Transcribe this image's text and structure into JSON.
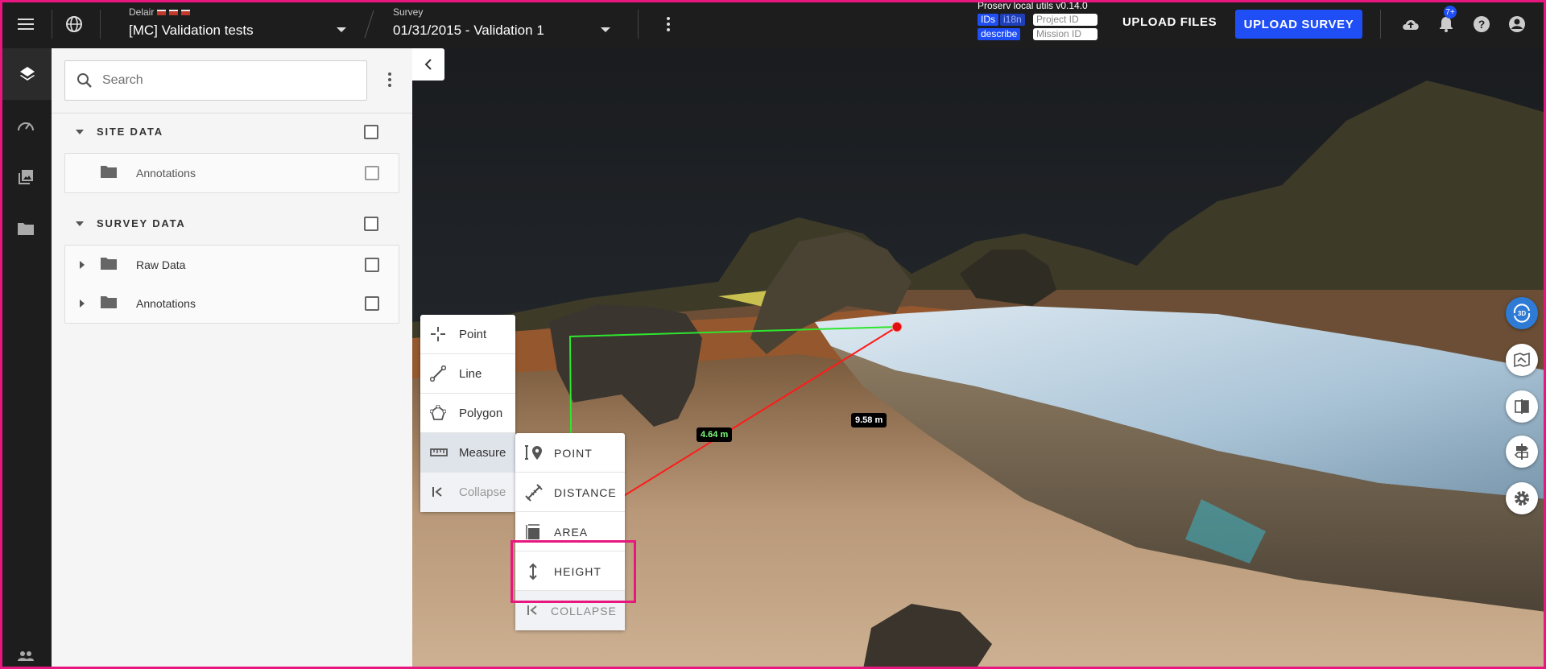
{
  "topbar": {
    "menu_icon": "hamburger-menu-icon",
    "globe_icon": "globe-icon",
    "project_caption": "Delair",
    "project_name": "[MC] Validation tests",
    "survey_caption": "Survey",
    "survey_name": "01/31/2015 - Validation 1",
    "dev_title": "Proserv local utils v0.14.0",
    "chip_ids": "IDs",
    "chip_i18n": "i18n",
    "project_id_placeholder": "Project ID",
    "chip_describe": "describe",
    "mission_id_placeholder": "Mission ID",
    "upload_files": "UPLOAD FILES",
    "upload_survey": "UPLOAD SURVEY",
    "notification_count": "7+",
    "brand_color": "#1f4ef5"
  },
  "rail": {
    "items": [
      "layers-icon",
      "speedometer-icon",
      "gallery-icon",
      "folder-icon"
    ],
    "bottom": "people-icon"
  },
  "panel": {
    "search_placeholder": "Search",
    "sections": [
      {
        "label": "SITE DATA",
        "items": [
          {
            "label": "Annotations"
          }
        ]
      },
      {
        "label": "SURVEY DATA",
        "items": [
          {
            "label": "Raw Data"
          },
          {
            "label": "Annotations"
          }
        ]
      }
    ]
  },
  "tools": {
    "items": [
      {
        "label": "Point",
        "icon": "crosshair-icon"
      },
      {
        "label": "Line",
        "icon": "line-icon"
      },
      {
        "label": "Polygon",
        "icon": "polygon-icon"
      },
      {
        "label": "Measure",
        "icon": "ruler-icon"
      },
      {
        "label": "Collapse",
        "icon": "collapse-icon"
      }
    ],
    "measure_items": [
      {
        "label": "POINT",
        "icon": "point-marker-icon"
      },
      {
        "label": "DISTANCE",
        "icon": "distance-icon"
      },
      {
        "label": "AREA",
        "icon": "area-icon"
      },
      {
        "label": "HEIGHT",
        "icon": "height-icon"
      },
      {
        "label": "COLLAPSE",
        "icon": "collapse-icon"
      }
    ]
  },
  "measurements": {
    "height_label": "4.64 m",
    "distance_label": "9.58 m"
  },
  "view_controls": {
    "mode_3d": "3D"
  }
}
